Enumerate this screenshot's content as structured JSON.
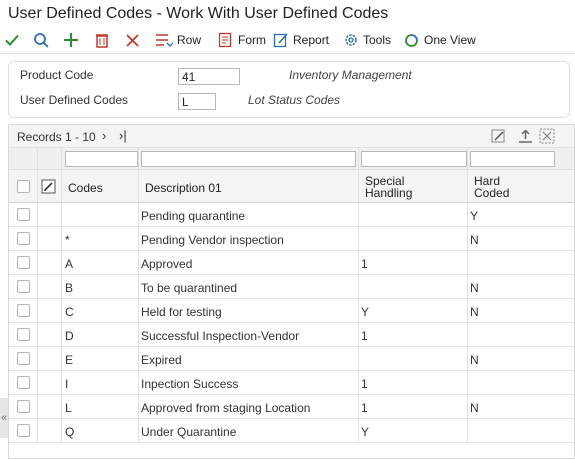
{
  "window": {
    "title": "User Defined Codes - Work With User Defined Codes"
  },
  "toolbar": {
    "ok_icon": "checkmark-icon",
    "find_icon": "search-icon",
    "add_icon": "plus-icon",
    "delete_icon": "trash-icon",
    "close_icon": "close-icon",
    "row_label": "Row",
    "form_label": "Form",
    "report_label": "Report",
    "tools_label": "Tools",
    "oneview_label": "One View",
    "colors": {
      "ok": "#2e8b2e",
      "find": "#2a6fb8",
      "add": "#2e8b2e",
      "delete": "#c0392b",
      "close": "#c0392b"
    }
  },
  "header": {
    "product_code_label": "Product Code",
    "product_code_value": "41",
    "product_code_desc": "Inventory Management",
    "udc_label": "User Defined Codes",
    "udc_value": "L",
    "udc_desc": "Lot Status Codes"
  },
  "grid": {
    "records": "Records 1 - 10",
    "columns": {
      "codes": "Codes",
      "description": "Description 01",
      "special_handling_1": "Special",
      "special_handling_2": "Handling",
      "hard_coded_1": "Hard",
      "hard_coded_2": "Coded"
    },
    "rows": [
      {
        "code": "",
        "description": "Pending quarantine",
        "special": "",
        "hard": "Y"
      },
      {
        "code": "*",
        "description": "Pending Vendor inspection",
        "special": "",
        "hard": "N"
      },
      {
        "code": "A",
        "description": "Approved",
        "special": "1",
        "hard": ""
      },
      {
        "code": "B",
        "description": "To be quarantined",
        "special": "",
        "hard": "N"
      },
      {
        "code": "C",
        "description": "Held for testing",
        "special": "Y",
        "hard": "N"
      },
      {
        "code": "D",
        "description": "Successful Inspection-Vendor",
        "special": "1",
        "hard": ""
      },
      {
        "code": "E",
        "description": "Expired",
        "special": "",
        "hard": "N"
      },
      {
        "code": "I",
        "description": "Inpection Success",
        "special": "1",
        "hard": ""
      },
      {
        "code": "L",
        "description": "Approved from staging Location",
        "special": "1",
        "hard": "N"
      },
      {
        "code": "Q",
        "description": "Under Quarantine",
        "special": "Y",
        "hard": ""
      }
    ]
  }
}
